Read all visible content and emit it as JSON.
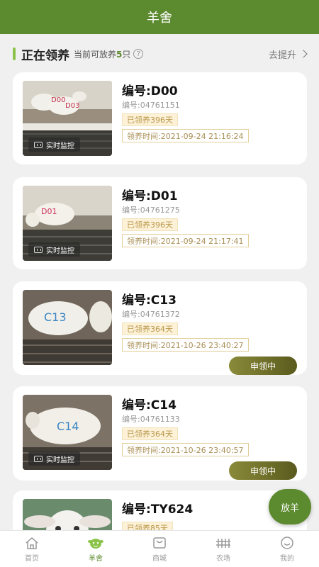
{
  "header": {
    "title": "羊舍"
  },
  "subheader": {
    "title": "正在领养",
    "hint_prefix": "当前可放养",
    "hint_count": "5",
    "hint_suffix": "只",
    "help_icon": "question-circle-icon",
    "upgrade_label": "去提升"
  },
  "live_label": "实时监控",
  "apply_label": "申领中",
  "sheep": [
    {
      "name": "编号:D00",
      "code": "编号:04761151",
      "days": "已领养396天",
      "time": "领养时间:2021-09-24 21:16:24",
      "live": true,
      "applying": false,
      "photo_tag": "D00 D03"
    },
    {
      "name": "编号:D01",
      "code": "编号:04761275",
      "days": "已领养396天",
      "time": "领养时间:2021-09-24 21:17:41",
      "live": true,
      "applying": false,
      "photo_tag": "D01"
    },
    {
      "name": "编号:C13",
      "code": "编号:04761372",
      "days": "已领养364天",
      "time": "领养时间:2021-10-26 23:40:27",
      "live": false,
      "applying": true,
      "photo_tag": "C13"
    },
    {
      "name": "编号:C14",
      "code": "编号:04761133",
      "days": "已领养364天",
      "time": "领养时间:2021-10-26 23:40:57",
      "live": true,
      "applying": true,
      "photo_tag": "C14"
    },
    {
      "name": "编号:TY624",
      "code": "",
      "days": "已领养85天",
      "time": "",
      "live": false,
      "applying": false,
      "photo_tag": ""
    }
  ],
  "fab_label": "放羊",
  "tabs": [
    {
      "label": "首页",
      "icon": "home-icon",
      "active": false
    },
    {
      "label": "羊舍",
      "icon": "sheep-icon",
      "active": true
    },
    {
      "label": "商城",
      "icon": "shop-icon",
      "active": false
    },
    {
      "label": "农场",
      "icon": "farm-icon",
      "active": false
    },
    {
      "label": "我的",
      "icon": "profile-icon",
      "active": false
    }
  ]
}
